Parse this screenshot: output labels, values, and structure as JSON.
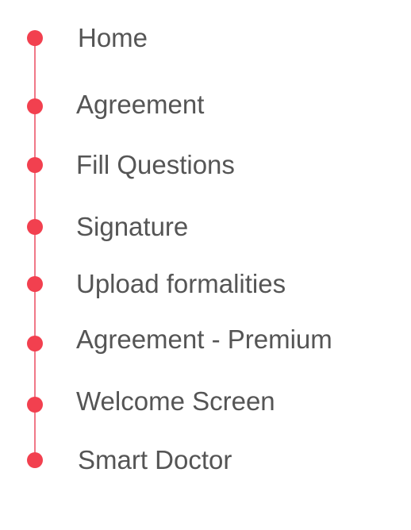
{
  "accent_color": "#f2404f",
  "rail_color": "#f07888",
  "steps": [
    {
      "label": "Home"
    },
    {
      "label": "Agreement"
    },
    {
      "label": "Fill Questions"
    },
    {
      "label": "Signature"
    },
    {
      "label": "Upload formalities"
    },
    {
      "label": "Agreement - Premium"
    },
    {
      "label": "Welcome Screen"
    },
    {
      "label": "Smart Doctor"
    }
  ]
}
